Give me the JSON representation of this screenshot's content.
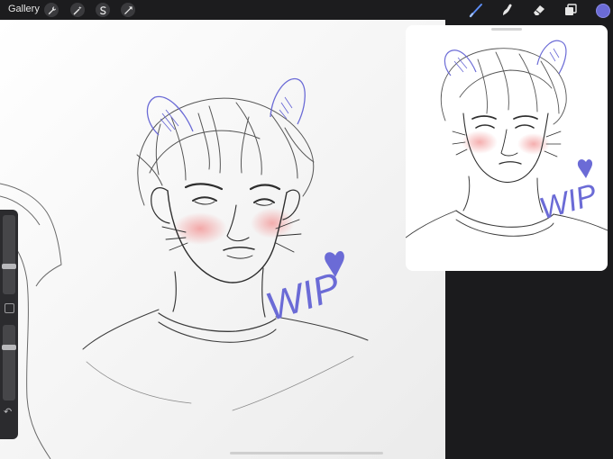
{
  "topbar": {
    "gallery_label": "Gallery",
    "left_tools": [
      "wrench-icon",
      "magic-wand-icon",
      "selection-icon",
      "transform-icon"
    ],
    "right_tools": [
      "brush-icon",
      "smudge-icon",
      "eraser-icon",
      "layers-icon"
    ],
    "current_color": "#6b6bd6"
  },
  "canvas": {
    "annotation_text": "WIP",
    "accent_color": "#6b6bd6"
  },
  "reference": {
    "annotation_text": "WIP"
  }
}
